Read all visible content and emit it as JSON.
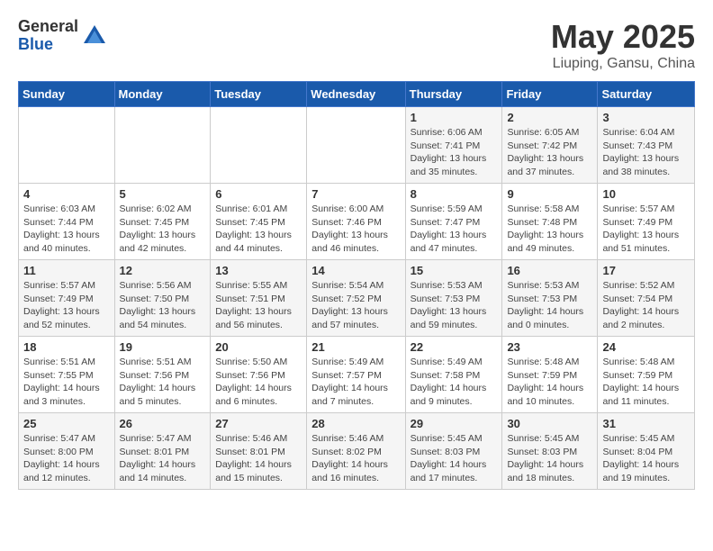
{
  "header": {
    "logo_general": "General",
    "logo_blue": "Blue",
    "month": "May 2025",
    "location": "Liuping, Gansu, China"
  },
  "weekdays": [
    "Sunday",
    "Monday",
    "Tuesday",
    "Wednesday",
    "Thursday",
    "Friday",
    "Saturday"
  ],
  "weeks": [
    [
      {
        "day": "",
        "info": ""
      },
      {
        "day": "",
        "info": ""
      },
      {
        "day": "",
        "info": ""
      },
      {
        "day": "",
        "info": ""
      },
      {
        "day": "1",
        "info": "Sunrise: 6:06 AM\nSunset: 7:41 PM\nDaylight: 13 hours\nand 35 minutes."
      },
      {
        "day": "2",
        "info": "Sunrise: 6:05 AM\nSunset: 7:42 PM\nDaylight: 13 hours\nand 37 minutes."
      },
      {
        "day": "3",
        "info": "Sunrise: 6:04 AM\nSunset: 7:43 PM\nDaylight: 13 hours\nand 38 minutes."
      }
    ],
    [
      {
        "day": "4",
        "info": "Sunrise: 6:03 AM\nSunset: 7:44 PM\nDaylight: 13 hours\nand 40 minutes."
      },
      {
        "day": "5",
        "info": "Sunrise: 6:02 AM\nSunset: 7:45 PM\nDaylight: 13 hours\nand 42 minutes."
      },
      {
        "day": "6",
        "info": "Sunrise: 6:01 AM\nSunset: 7:45 PM\nDaylight: 13 hours\nand 44 minutes."
      },
      {
        "day": "7",
        "info": "Sunrise: 6:00 AM\nSunset: 7:46 PM\nDaylight: 13 hours\nand 46 minutes."
      },
      {
        "day": "8",
        "info": "Sunrise: 5:59 AM\nSunset: 7:47 PM\nDaylight: 13 hours\nand 47 minutes."
      },
      {
        "day": "9",
        "info": "Sunrise: 5:58 AM\nSunset: 7:48 PM\nDaylight: 13 hours\nand 49 minutes."
      },
      {
        "day": "10",
        "info": "Sunrise: 5:57 AM\nSunset: 7:49 PM\nDaylight: 13 hours\nand 51 minutes."
      }
    ],
    [
      {
        "day": "11",
        "info": "Sunrise: 5:57 AM\nSunset: 7:49 PM\nDaylight: 13 hours\nand 52 minutes."
      },
      {
        "day": "12",
        "info": "Sunrise: 5:56 AM\nSunset: 7:50 PM\nDaylight: 13 hours\nand 54 minutes."
      },
      {
        "day": "13",
        "info": "Sunrise: 5:55 AM\nSunset: 7:51 PM\nDaylight: 13 hours\nand 56 minutes."
      },
      {
        "day": "14",
        "info": "Sunrise: 5:54 AM\nSunset: 7:52 PM\nDaylight: 13 hours\nand 57 minutes."
      },
      {
        "day": "15",
        "info": "Sunrise: 5:53 AM\nSunset: 7:53 PM\nDaylight: 13 hours\nand 59 minutes."
      },
      {
        "day": "16",
        "info": "Sunrise: 5:53 AM\nSunset: 7:53 PM\nDaylight: 14 hours\nand 0 minutes."
      },
      {
        "day": "17",
        "info": "Sunrise: 5:52 AM\nSunset: 7:54 PM\nDaylight: 14 hours\nand 2 minutes."
      }
    ],
    [
      {
        "day": "18",
        "info": "Sunrise: 5:51 AM\nSunset: 7:55 PM\nDaylight: 14 hours\nand 3 minutes."
      },
      {
        "day": "19",
        "info": "Sunrise: 5:51 AM\nSunset: 7:56 PM\nDaylight: 14 hours\nand 5 minutes."
      },
      {
        "day": "20",
        "info": "Sunrise: 5:50 AM\nSunset: 7:56 PM\nDaylight: 14 hours\nand 6 minutes."
      },
      {
        "day": "21",
        "info": "Sunrise: 5:49 AM\nSunset: 7:57 PM\nDaylight: 14 hours\nand 7 minutes."
      },
      {
        "day": "22",
        "info": "Sunrise: 5:49 AM\nSunset: 7:58 PM\nDaylight: 14 hours\nand 9 minutes."
      },
      {
        "day": "23",
        "info": "Sunrise: 5:48 AM\nSunset: 7:59 PM\nDaylight: 14 hours\nand 10 minutes."
      },
      {
        "day": "24",
        "info": "Sunrise: 5:48 AM\nSunset: 7:59 PM\nDaylight: 14 hours\nand 11 minutes."
      }
    ],
    [
      {
        "day": "25",
        "info": "Sunrise: 5:47 AM\nSunset: 8:00 PM\nDaylight: 14 hours\nand 12 minutes."
      },
      {
        "day": "26",
        "info": "Sunrise: 5:47 AM\nSunset: 8:01 PM\nDaylight: 14 hours\nand 14 minutes."
      },
      {
        "day": "27",
        "info": "Sunrise: 5:46 AM\nSunset: 8:01 PM\nDaylight: 14 hours\nand 15 minutes."
      },
      {
        "day": "28",
        "info": "Sunrise: 5:46 AM\nSunset: 8:02 PM\nDaylight: 14 hours\nand 16 minutes."
      },
      {
        "day": "29",
        "info": "Sunrise: 5:45 AM\nSunset: 8:03 PM\nDaylight: 14 hours\nand 17 minutes."
      },
      {
        "day": "30",
        "info": "Sunrise: 5:45 AM\nSunset: 8:03 PM\nDaylight: 14 hours\nand 18 minutes."
      },
      {
        "day": "31",
        "info": "Sunrise: 5:45 AM\nSunset: 8:04 PM\nDaylight: 14 hours\nand 19 minutes."
      }
    ]
  ]
}
